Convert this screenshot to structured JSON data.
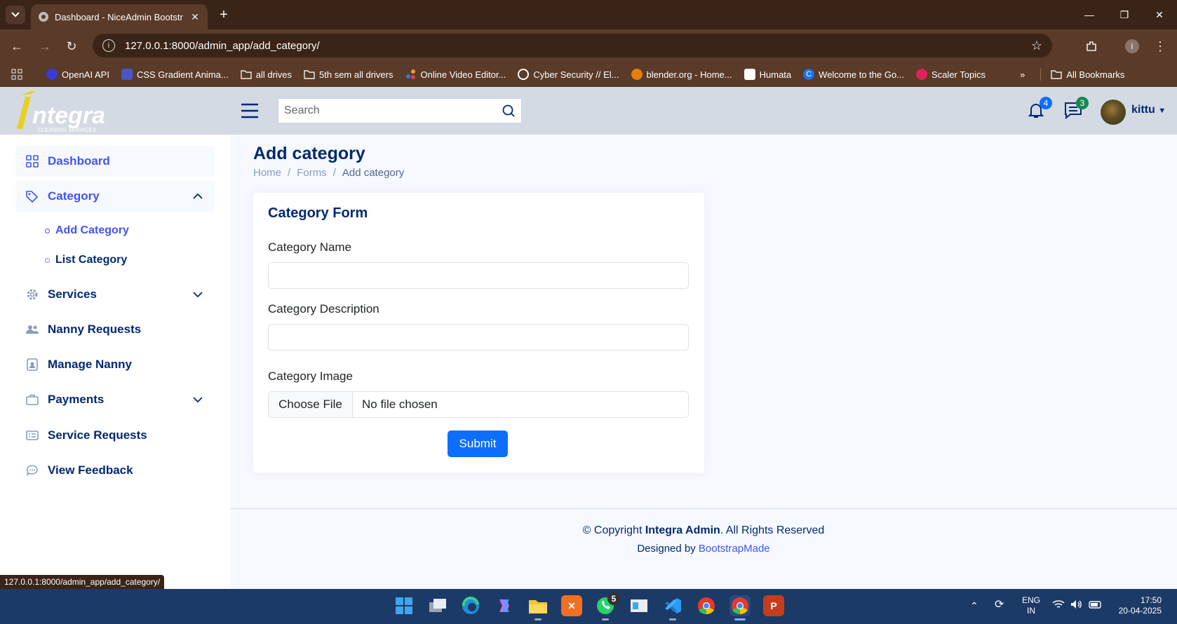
{
  "browser": {
    "tab_title": "Dashboard - NiceAdmin Bootstr",
    "url": "127.0.0.1:8000/admin_app/add_category/",
    "bookmarks": [
      {
        "label": "OpenAI API",
        "icon": "openai-icon",
        "color": "#3b3bd6"
      },
      {
        "label": "CSS Gradient Anima...",
        "icon": "css-gradient-icon",
        "color": "#4a55c8"
      },
      {
        "label": "all drives",
        "icon": "folder-icon",
        "color": "none"
      },
      {
        "label": "5th sem all drivers",
        "icon": "folder-icon",
        "color": "none"
      },
      {
        "label": "Online Video Editor...",
        "icon": "video-editor-icon",
        "color": "#e8a020"
      },
      {
        "label": "Cyber Security // El...",
        "icon": "cyber-icon",
        "color": "#ffffff"
      },
      {
        "label": "blender.org - Home...",
        "icon": "blender-icon",
        "color": "#e87d0d"
      },
      {
        "label": "Humata",
        "icon": "humata-icon",
        "color": "#ffffff"
      },
      {
        "label": "Welcome to the Go...",
        "icon": "go-icon",
        "color": "#1a73e8"
      },
      {
        "label": "Scaler Topics",
        "icon": "scaler-icon",
        "color": "#e0225b"
      }
    ],
    "all_bookmarks": "All Bookmarks"
  },
  "header": {
    "logo_text": "ntegra",
    "logo_sub": "CLEANING  SERVICES",
    "search_placeholder": "Search",
    "notifications_count": "4",
    "messages_count": "3",
    "user_name": "kittu"
  },
  "sidebar": {
    "items": [
      {
        "label": "Dashboard",
        "icon": "grid-icon"
      },
      {
        "label": "Category",
        "icon": "tags-icon"
      },
      {
        "label": "Services",
        "icon": "gear-icon"
      },
      {
        "label": "Nanny Requests",
        "icon": "people-icon"
      },
      {
        "label": "Manage Nanny",
        "icon": "person-badge-icon"
      },
      {
        "label": "Payments",
        "icon": "briefcase-icon"
      },
      {
        "label": "Service Requests",
        "icon": "card-list-icon"
      },
      {
        "label": "View Feedback",
        "icon": "chat-dots-icon"
      }
    ],
    "sub_items": [
      {
        "label": "Add Category"
      },
      {
        "label": "List Category"
      }
    ]
  },
  "main": {
    "page_title": "Add category",
    "breadcrumb": [
      "Home",
      "Forms",
      "Add category"
    ],
    "card_title": "Category Form",
    "fields": {
      "name_label": "Category Name",
      "name_value": "",
      "description_label": "Category Description",
      "description_value": "",
      "image_label": "Category Image",
      "file_button": "Choose File",
      "file_status": "No file chosen"
    },
    "submit_label": "Submit"
  },
  "footer": {
    "copyright_prefix": "© Copyright ",
    "brand": "Integra Admin",
    "copyright_suffix": ". All Rights Reserved",
    "designed_by": "Designed by ",
    "designer": "BootstrapMade"
  },
  "status_url": "127.0.0.1:8000/admin_app/add_category/",
  "taskbar": {
    "whatsapp_badge": "5",
    "lang_top": "ENG",
    "lang_bottom": "IN",
    "time": "17:50",
    "date": "20-04-2025"
  },
  "colors": {
    "brand_navy": "#012970",
    "accent_blue": "#4154f1",
    "submit_blue": "#0d6efd",
    "notif_badge": "#0d6efd",
    "msg_badge": "#198754"
  }
}
